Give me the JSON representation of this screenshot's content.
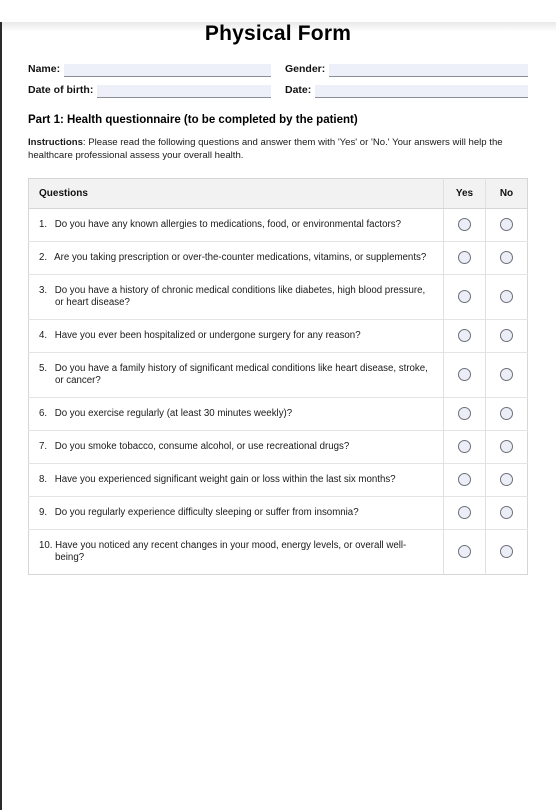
{
  "document": {
    "title": "Physical Form"
  },
  "identity": {
    "fields": [
      {
        "label": "Name:",
        "value": "",
        "placeholder": ""
      },
      {
        "label": "Gender:",
        "value": "",
        "placeholder": ""
      },
      {
        "label": "Date of birth:",
        "value": "",
        "placeholder": ""
      },
      {
        "label": "Date:",
        "value": "",
        "placeholder": ""
      }
    ]
  },
  "part1": {
    "heading": "Part 1: Health questionnaire (to be completed by the patient)",
    "instructions_label": "Instructions",
    "instructions_text": ": Please read the following questions and answer them with 'Yes' or 'No.' Your answers will help the healthcare professional assess your overall health."
  },
  "table": {
    "headers": {
      "questions": "Questions",
      "yes": "Yes",
      "no": "No"
    },
    "rows": [
      {
        "number": "1.",
        "text": "Do you have any known allergies to medications, food, or environmental factors?"
      },
      {
        "number": "2.",
        "text": "Are you taking prescription or over-the-counter medications, vitamins, or supplements?"
      },
      {
        "number": "3.",
        "text": "Do you have a history of chronic medical conditions like diabetes, high blood pressure, or heart disease?"
      },
      {
        "number": "4.",
        "text": "Have you ever been hospitalized or undergone surgery for any reason?"
      },
      {
        "number": "5.",
        "text": "Do you have a family history of significant medical conditions like heart disease, stroke, or cancer?"
      },
      {
        "number": "6.",
        "text": "Do you exercise regularly (at least 30 minutes weekly)?"
      },
      {
        "number": "7.",
        "text": "Do you smoke tobacco, consume alcohol, or use recreational drugs?"
      },
      {
        "number": "8.",
        "text": "Have you experienced significant weight gain or loss within the last six months?"
      },
      {
        "number": "9.",
        "text": "Do you regularly experience difficulty sleeping or suffer from insomnia?"
      },
      {
        "number": "10.",
        "text": "Have you noticed any recent changes in your mood, energy levels, or overall well-being?"
      }
    ]
  },
  "colors": {
    "field_fill": "#edf0f8",
    "field_underline": "#8c8c96",
    "table_header_bg": "#f2f2f2",
    "table_border": "#d6d6d6",
    "radio_fill": "#eceef7",
    "radio_border": "#6f6f79"
  }
}
